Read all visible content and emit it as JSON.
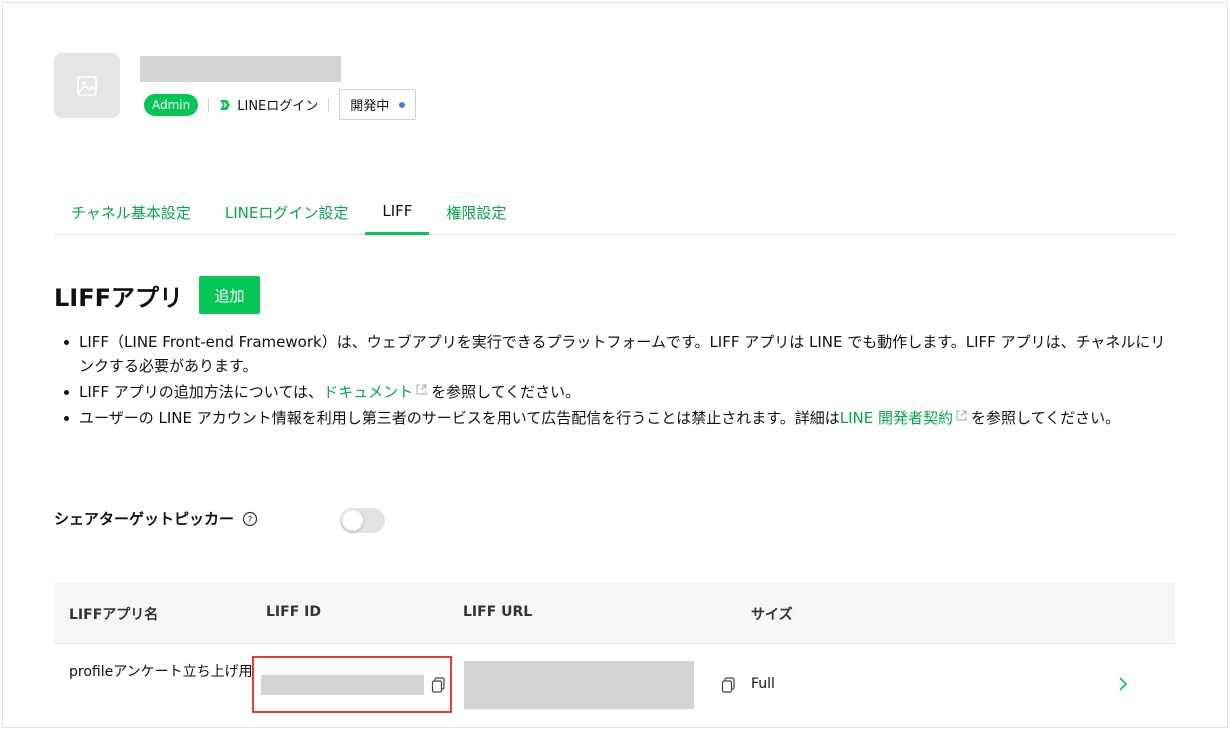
{
  "header": {
    "badge": "Admin",
    "login_type": "LINEログイン",
    "status": "開発中",
    "status_color": "#4a7fd8"
  },
  "tabs": [
    {
      "label": "チャネル基本設定",
      "active": false
    },
    {
      "label": "LINEログイン設定",
      "active": false
    },
    {
      "label": "LIFF",
      "active": true
    },
    {
      "label": "権限設定",
      "active": false
    }
  ],
  "section": {
    "title": "LIFFアプリ",
    "add_label": "追加"
  },
  "notes": {
    "n1": "LIFF（LINE Front-end Framework）は、ウェブアプリを実行できるプラットフォームです。LIFF アプリは LINE でも動作します。LIFF アプリは、チャネルにリンクする必要があります。",
    "n2_pre": "LIFF アプリの追加方法については、",
    "n2_link": "ドキュメント",
    "n2_post": "を参照してください。",
    "n3_pre": "ユーザーの LINE アカウント情報を利用し第三者のサービスを用いて広告配信を行うことは禁止されます。詳細は",
    "n3_link": "LINE 開発者契約",
    "n3_post": "を参照してください。"
  },
  "share_target_picker": {
    "label": "シェアターゲットピッカー",
    "enabled": false
  },
  "table": {
    "columns": [
      "LIFFアプリ名",
      "LIFF ID",
      "LIFF URL",
      "サイズ"
    ],
    "rows": [
      {
        "name": "profileアンケート立ち上げ用",
        "size": "Full"
      }
    ]
  },
  "colors": {
    "accent": "#06c755",
    "link": "#06a94a",
    "highlight": "#e2412a"
  }
}
